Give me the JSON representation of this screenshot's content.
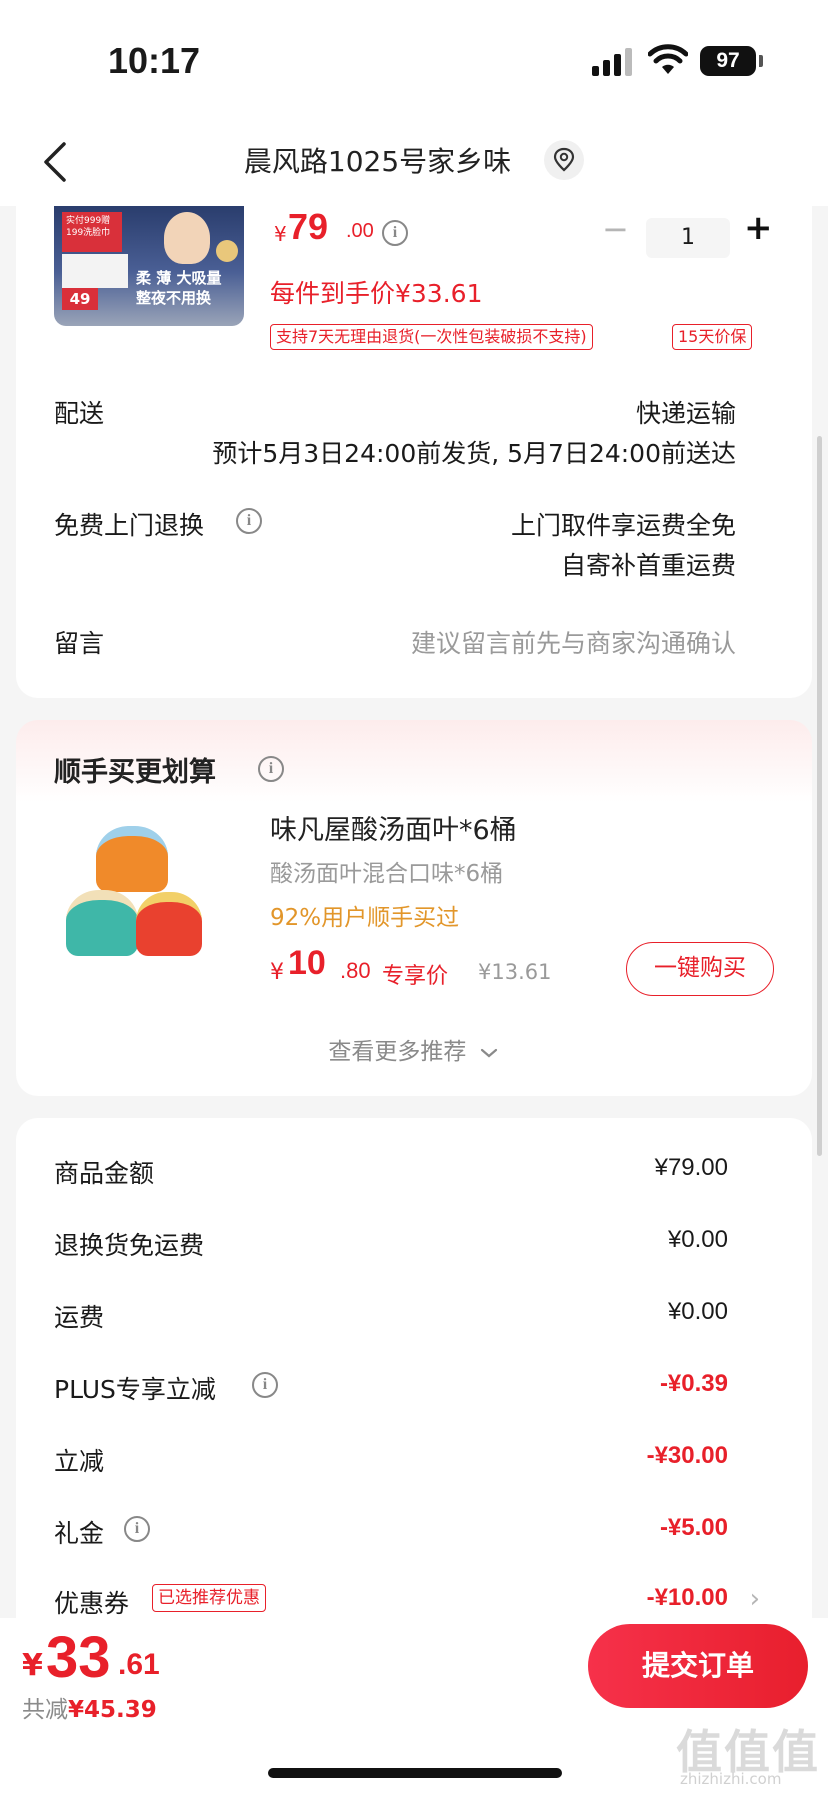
{
  "status_bar": {
    "time": "10:17",
    "battery": "97"
  },
  "nav": {
    "title": "晨风路1025号家乡味"
  },
  "product": {
    "image_text": {
      "tag": "实付999赠 199洗脸巾",
      "count": "49",
      "slogan_1": "柔 薄 大吸量",
      "slogan_2": "整夜不用换"
    },
    "currency": "¥",
    "price_int": "79",
    "price_dec": ".00",
    "quantity": "1",
    "minus_symbol": "−",
    "plus_symbol": "+",
    "unit_price": "每件到手价¥33.61",
    "tag_return": "支持7天无理由退货(一次性包装破损不支持)",
    "tag_price_protect": "15天价保"
  },
  "delivery": {
    "label": "配送",
    "method": "快递运输",
    "estimate": "预计5月3日24:00前发货, 5月7日24:00前送达"
  },
  "free_return": {
    "label": "免费上门退换",
    "line1": "上门取件享运费全免",
    "line2": "自寄补首重运费"
  },
  "message": {
    "label": "留言",
    "placeholder": "建议留言前先与商家沟通确认"
  },
  "recommend": {
    "title": "顺手买更划算",
    "name": "味凡屋酸汤面叶*6桶",
    "subtitle": "酸汤面叶混合口味*6桶",
    "buy_rate": "92%用户顺手买过",
    "currency": "¥",
    "price_int": "10",
    "price_dec": ".80",
    "price_label": "专享价",
    "original_price": "¥13.61",
    "buy_button": "一键购买",
    "more_link": "查看更多推荐"
  },
  "summary": [
    {
      "label": "商品金额",
      "value": "¥79.00",
      "red": false
    },
    {
      "label": "退换货免运费",
      "value": "¥0.00",
      "red": false
    },
    {
      "label": "运费",
      "value": "¥0.00",
      "red": false
    },
    {
      "label": "PLUS专享立减",
      "value": "-¥0.39",
      "red": true
    },
    {
      "label": "立减",
      "value": "-¥30.00",
      "red": true
    },
    {
      "label": "礼金",
      "value": "-¥5.00",
      "red": true
    },
    {
      "label": "优惠券",
      "value": "-¥10.00",
      "red": true
    }
  ],
  "coupon_tag": "已选推荐优惠",
  "bottom": {
    "currency": "¥",
    "total_int": "33",
    "total_dec": ".61",
    "saved_label": "共减",
    "saved_value": "¥45.39",
    "submit": "提交订单",
    "watermark": "值值值",
    "watermark_url": "zhizhizhi.com"
  }
}
